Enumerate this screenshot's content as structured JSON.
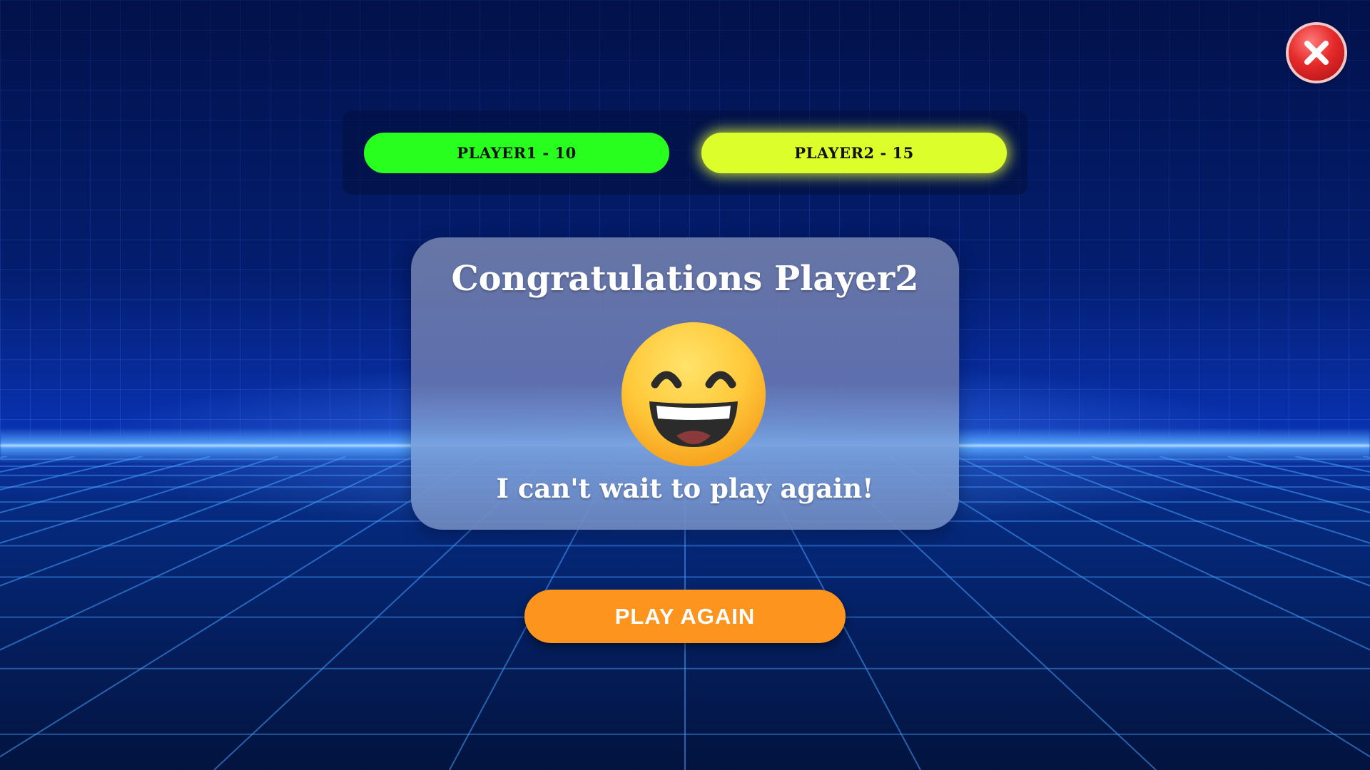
{
  "scoreboard": {
    "player1": {
      "label": "PLAYER1 - 10",
      "color": "#29ff1f"
    },
    "player2": {
      "label": "PLAYER2 - 15",
      "color": "#dcff2c"
    }
  },
  "result_modal": {
    "title": "Congratulations Player2",
    "emoji_icon": "grinning-face-with-smiling-eyes-icon",
    "message": "I can't wait to play again!"
  },
  "actions": {
    "play_again_label": "PLAY AGAIN",
    "play_again_color": "#fc941e",
    "close_icon": "close-icon"
  },
  "theme": {
    "background": "neon-grid-blue"
  }
}
